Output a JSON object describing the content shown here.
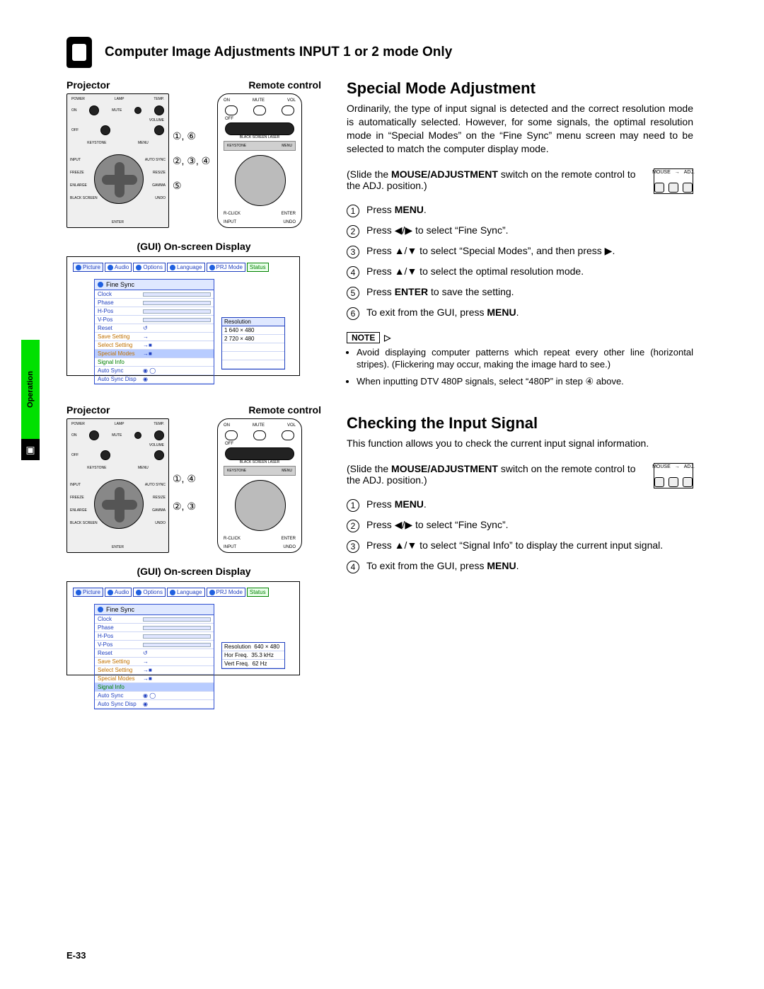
{
  "side_tab": "Operation",
  "header_title": "Computer Image Adjustments INPUT 1 or 2 mode Only",
  "labels": {
    "projector": "Projector",
    "remote": "Remote control",
    "gui": "(GUI) On-screen Display"
  },
  "projector_buttons": {
    "top": [
      "POWER",
      "LAMP",
      "TEMP."
    ],
    "row1": [
      "ON",
      "MUTE",
      "+"
    ],
    "vol": "VOLUME",
    "row2": [
      "OFF",
      "",
      "−"
    ],
    "row3": [
      "KEYSTONE",
      "MENU"
    ],
    "side_left": [
      "INPUT",
      "FREEZE",
      "ENLARGE",
      "BLACK SCREEN"
    ],
    "side_right": [
      "AUTO SYNC",
      "RESIZE",
      "GAMMA",
      "UNDO"
    ],
    "enter": "ENTER"
  },
  "remote_buttons": {
    "top_left": "ON",
    "top_mid": "MUTE",
    "top_right": "VOL",
    "off": "OFF",
    "black": "BLACK SCREEN",
    "laser": "LASER",
    "bar_left": "KEYSTONE",
    "bar_right": "MENU",
    "rclick": "R-CLICK",
    "enter": "ENTER",
    "bot_left": "INPUT",
    "bot_right": "UNDO"
  },
  "callouts_a": [
    "①, ⑥",
    "②, ③, ④",
    "⑤"
  ],
  "callouts_b": [
    "①, ④",
    "②, ③"
  ],
  "menu_tabs": [
    "Picture",
    "Audio",
    "Options",
    "Language",
    "PRJ Mode",
    "Status"
  ],
  "fine_sync": {
    "title": "Fine Sync",
    "adjust_rows": [
      "Clock",
      "Phase",
      "H-Pos",
      "V-Pos",
      "Reset"
    ],
    "option_rows": [
      {
        "label": "Save Setting",
        "icon": "orange"
      },
      {
        "label": "Select Setting",
        "icon": "orange"
      },
      {
        "label": "Special Modes",
        "icon": "orange",
        "highlight_a": true
      },
      {
        "label": "Signal Info",
        "icon": "green",
        "highlight_b": true
      },
      {
        "label": "Auto Sync",
        "icon": "blue"
      },
      {
        "label": "Auto Sync Disp",
        "icon": "blue"
      }
    ]
  },
  "resolution_box_a": {
    "head": "Resolution",
    "rows": [
      "1  640 × 480",
      "2  720 × 480"
    ]
  },
  "signal_box_b": {
    "rows": [
      {
        "k": "Resolution",
        "v": "640 × 480"
      },
      {
        "k": "Hor Freq.",
        "v": "35.3 kHz"
      },
      {
        "k": "Vert Freq.",
        "v": "62 Hz"
      }
    ]
  },
  "section_a": {
    "title": "Special Mode Adjustment",
    "intro": "Ordinarily, the type of input signal is detected and the correct resolution mode is automatically selected. However, for some signals, the optimal resolution mode in “Special Modes” on the “Fine Sync” menu screen may need to be selected to match the computer display mode.",
    "slide_pre": "(Slide the ",
    "slide_bold": "MOUSE/ADJUSTMENT",
    "slide_post": " switch on the remote control to the ADJ. position.)",
    "switch_labels": {
      "mouse": "MOUSE",
      "adj": "ADJ."
    },
    "steps": [
      "Press MENU.",
      "Press ◀/▶ to select “Fine Sync”.",
      "Press ▲/▼ to select “Special Modes”, and then press ▶.",
      "Press ▲/▼ to select the optimal resolution mode.",
      "Press ENTER to save the setting.",
      "To exit from the GUI, press MENU."
    ],
    "note_label": "NOTE",
    "notes": [
      "Avoid displaying computer patterns which repeat every other line (horizontal stripes). (Flickering may occur, making the image hard to see.)",
      "When inputting DTV 480P signals, select “480P” in step ④ above."
    ]
  },
  "section_b": {
    "title": "Checking the Input Signal",
    "intro": "This function allows you to check the current input signal information.",
    "slide_pre": "(Slide the ",
    "slide_bold": "MOUSE/ADJUSTMENT",
    "slide_post": " switch on the remote control to the ADJ. position.)",
    "steps": [
      "Press MENU.",
      "Press ◀/▶ to select “Fine Sync”.",
      "Press ▲/▼ to select “Signal Info” to display the current input signal.",
      "To exit from the GUI, press MENU."
    ]
  },
  "page_number": "E-33"
}
